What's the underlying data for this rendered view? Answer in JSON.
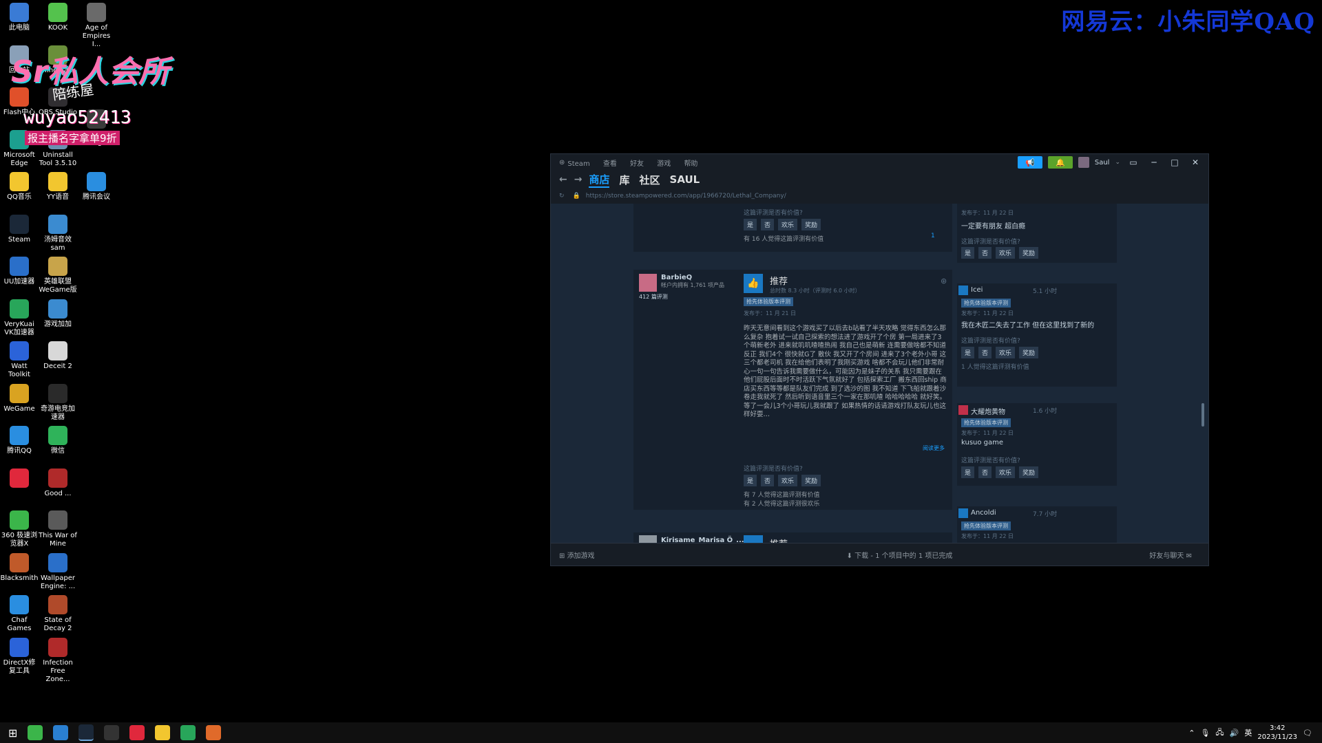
{
  "watermark": "网易云：小朱同学QAQ",
  "streamer": {
    "title": "Sr私人会所",
    "stamp": "陪练屋",
    "id": "wuyao52413",
    "sub": "报主播名字拿单9折"
  },
  "desktop_icons": [
    {
      "label": "此电脑",
      "color": "#3a7bd5"
    },
    {
      "label": "回收站",
      "color": "#8aa0b8"
    },
    {
      "label": "Flash中心",
      "color": "#e0502a"
    },
    {
      "label": "Microsoft Edge",
      "color": "#1c9f8f"
    },
    {
      "label": "QQ音乐",
      "color": "#f2c62f"
    },
    {
      "label": "Steam",
      "color": "#1b2838"
    },
    {
      "label": "UU加速器",
      "color": "#2a6fc9"
    },
    {
      "label": "VeryKuai VK加速器",
      "color": "#28a65a"
    },
    {
      "label": "Watt Toolkit",
      "color": "#2b63d9"
    },
    {
      "label": "WeGame",
      "color": "#d9a321"
    },
    {
      "label": "腾讯QQ",
      "color": "#2a8ee0"
    },
    {
      "label": "",
      "color": "#e0283c"
    },
    {
      "label": "360 极速浏览器X",
      "color": "#3bb54a"
    },
    {
      "label": "Blacksmith",
      "color": "#c05a2a"
    },
    {
      "label": "Chaf Games",
      "color": "#2a8ee0"
    },
    {
      "label": "DirectX修复工具",
      "color": "#2b63d9"
    }
  ],
  "desktop_icons2": [
    {
      "label": "KOOK",
      "color": "#54c24d"
    },
    {
      "label": "Minecra...",
      "color": "#6a8f3a"
    },
    {
      "label": "OBS Studio",
      "color": "#302e31"
    },
    {
      "label": "Uninstall Tool 3.5.10",
      "color": "#6a8fb0"
    },
    {
      "label": "YY语音",
      "color": "#f2c62f"
    },
    {
      "label": "汤姆音效sam",
      "color": "#3b8bd0"
    },
    {
      "label": "英雄联盟WeGame版",
      "color": "#c8a44a"
    },
    {
      "label": "游戏加加",
      "color": "#3b8bd0"
    },
    {
      "label": "Deceit 2",
      "color": "#d8d8d8"
    },
    {
      "label": "奇游电竞加速器",
      "color": "#2a2a2a"
    },
    {
      "label": "微信",
      "color": "#2fb35a"
    },
    {
      "label": "Good ...",
      "color": "#b02a2a"
    },
    {
      "label": "This War of Mine",
      "color": "#5a5a5a"
    },
    {
      "label": "Wallpaper Engine: ...",
      "color": "#2a6fc9"
    },
    {
      "label": "State of Decay 2",
      "color": "#b04a2a"
    },
    {
      "label": "Infection Free Zone...",
      "color": "#b02a2a"
    }
  ],
  "desktop_icons3": [
    {
      "label": "Age of Empires I...",
      "color": "#6a6a6a"
    },
    {
      "label": "Dread Hunger",
      "color": "#3a3a3a"
    },
    {
      "label": "腾讯会议",
      "color": "#2a8ee0"
    }
  ],
  "steam": {
    "menu": [
      "Steam",
      "查看",
      "好友",
      "游戏",
      "帮助"
    ],
    "user": "Saul",
    "tabs": [
      "商店",
      "库",
      "社区",
      "SAUL"
    ],
    "url": "https://store.steampowered.com/app/1966720/Lethal_Company/",
    "footer": {
      "add_game": "添加游戏",
      "download": "下载 - 1 个项目中的 1 项已完成",
      "friends": "好友与聊天"
    },
    "vote": {
      "question": "这篇评测是否有价值?",
      "yes": "是",
      "no": "否",
      "funny": "欢乐",
      "award": "奖励"
    },
    "top_review": {
      "helpful": "有 16 人觉得这篇评测有价值",
      "comments": "1"
    },
    "main_review": {
      "name": "BarbieQ",
      "owned": "帐户内拥有 1,761 项产品",
      "reviews": "412 篇评测",
      "recommend": "推荐",
      "hours": "总时数 8.3 小时（评测时 6.0 小时）",
      "tag": "抢先体验版本评测",
      "date": "发布于：11 月 21 日",
      "text": "昨天无意间看到这个游戏买了以后去b站看了半天攻略 觉得东西怎么那么复杂 抱着试一试自己探索的想法进了游戏开了个房 第一局进来了3个萌新老外 进来就叽叽喳喳热闹 我自己也是萌新 连需要做啥都不知道 反正 我们4个 很快就G了 散伙 我又开了个房间 进来了3个老外小哥 这三个都老司机 我在给他们表明了我刚买游戏 啥都不会玩儿他们非常耐心一句一句告诉我需要做什么，可能因为是妹子的关系 我只需要跟在他们屁股后面时不时活跃下气氛就好了 包括探索工厂 搬东西回ship 商店买东西等等都是队友们完成 到了选沙的图 我不知道 下飞船就跟着沙卷走我就死了 然后听到语音里三个一家在那叽喳 哈哈哈哈哈 就好笑。 等了一会儿3个小哥玩儿我就跟了 如果热情的话请游戏打队友玩儿也这样好耍…",
      "more": "阅读更多",
      "helpful1": "有 7 人觉得这篇评测有价值",
      "helpful2": "有 2 人觉得这篇评测很欢乐"
    },
    "next_review": {
      "name": "Kirisame_Marisa Ö_...",
      "recommend": "推荐"
    },
    "side_reviews": [
      {
        "date": "发布于：11 月 22 日",
        "text": "一定要有朋友 超白瘾"
      },
      {
        "name": "Icei",
        "hours": "5.1 小时",
        "tag": "抢先体验版本评测",
        "date": "发布于：11 月 22 日",
        "text": "我在木匠二失去了工作 但在这里找到了新的",
        "helpful": "1 人觉得这篇评测有价值"
      },
      {
        "name": "大耀炮黄物",
        "hours": "1.6 小时",
        "tag": "抢先体验版本评测",
        "date": "发布于：11 月 22 日",
        "text": "kusuo game"
      },
      {
        "name": "Ancoldi",
        "hours": "7.7 小时",
        "tag": "抢先体验版本评测",
        "date": "发布于：11 月 22 日"
      }
    ]
  },
  "tray": {
    "ime": "英",
    "time": "3:42",
    "date": "2023/11/23"
  }
}
